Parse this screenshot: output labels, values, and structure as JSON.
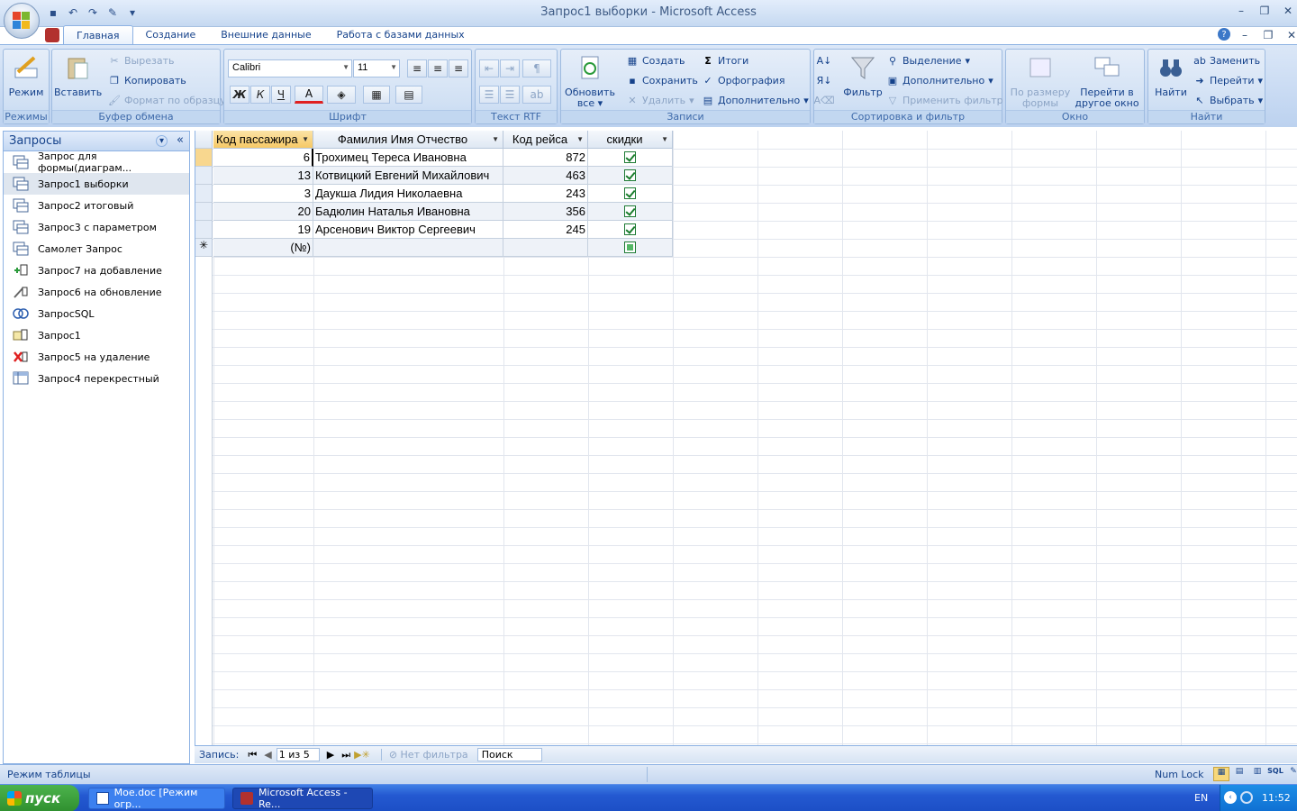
{
  "window": {
    "title": "Запрос1 выборки - Microsoft Access"
  },
  "tabs": [
    "Главная",
    "Создание",
    "Внешние данные",
    "Работа с базами данных"
  ],
  "ribbon": {
    "modes": {
      "group": "Режимы",
      "view": "Режим"
    },
    "clipboard": {
      "group": "Буфер обмена",
      "paste": "Вставить",
      "cut": "Вырезать",
      "copy": "Копировать",
      "format_painter": "Формат по образцу"
    },
    "font": {
      "group": "Шрифт",
      "family": "Calibri",
      "size": "11",
      "bold": "Ж",
      "italic": "К",
      "underline": "Ч",
      "font_color_glyph": "А"
    },
    "rtf": {
      "group": "Текст RTF"
    },
    "records": {
      "group": "Записи",
      "refresh": "Обновить все",
      "new": "Создать",
      "save": "Сохранить",
      "delete": "Удалить",
      "totals": "Итоги",
      "spelling": "Орфография",
      "more": "Дополнительно"
    },
    "sort": {
      "group": "Сортировка и фильтр",
      "filter": "Фильтр",
      "selection": "Выделение",
      "advanced": "Дополнительно",
      "toggle": "Применить фильтр"
    },
    "window": {
      "group": "Окно",
      "fit": "По размеру формы",
      "switch": "Перейти в другое окно"
    },
    "find": {
      "group": "Найти",
      "find": "Найти",
      "replace": "Заменить",
      "goto": "Перейти",
      "select": "Выбрать"
    }
  },
  "nav": {
    "header": "Запросы",
    "items": [
      {
        "label": "Запрос для формы(диаграм...",
        "icon": "select-query-icon"
      },
      {
        "label": "Запрос1 выборки",
        "icon": "select-query-icon",
        "selected": true
      },
      {
        "label": "Запрос2 итоговый",
        "icon": "select-query-icon"
      },
      {
        "label": "Запрос3 с параметром",
        "icon": "select-query-icon"
      },
      {
        "label": "Самолет Запрос",
        "icon": "select-query-icon"
      },
      {
        "label": "Запрос7 на добавление",
        "icon": "append-query-icon"
      },
      {
        "label": "Запрос6 на обновление",
        "icon": "update-query-icon"
      },
      {
        "label": "ЗапросSQL",
        "icon": "union-query-icon"
      },
      {
        "label": "Запрос1",
        "icon": "make-table-query-icon"
      },
      {
        "label": "Запрос5 на удаление",
        "icon": "delete-query-icon"
      },
      {
        "label": "Запрос4 перекрестный",
        "icon": "crosstab-query-icon"
      }
    ]
  },
  "table": {
    "columns": [
      "Код пассажира",
      "Фамилия Имя Отчество",
      "Код рейса",
      "скидки"
    ],
    "rows": [
      {
        "id": "6",
        "name": "Трохимец Тереса Ивановна",
        "flight": "872",
        "discount": true
      },
      {
        "id": "13",
        "name": "Котвицкий Евгений Михайлович",
        "flight": "463",
        "discount": true
      },
      {
        "id": "3",
        "name": "Даукша Лидия Николаевна",
        "flight": "243",
        "discount": true
      },
      {
        "id": "20",
        "name": "Бадюлин Наталья Ивановна",
        "flight": "356",
        "discount": true
      },
      {
        "id": "19",
        "name": "Арсенович Виктор Сергеевич",
        "flight": "245",
        "discount": true
      }
    ],
    "new_row": {
      "marker": "✳",
      "id": "(№)"
    }
  },
  "record_nav": {
    "label": "Запись:",
    "position": "1 из 5",
    "filter": "Нет фильтра",
    "search": "Поиск"
  },
  "status": {
    "mode": "Режим таблицы",
    "numlock": "Num Lock"
  },
  "taskbar": {
    "start": "пуск",
    "tasks": [
      "Мое.doc [Режим огр...",
      "Microsoft Access - Re..."
    ],
    "lang": "EN",
    "time": "11:52"
  },
  "colors": {
    "accent": "#15428b",
    "ribbon": "#c5d8f2",
    "taskbar": "#2459d1"
  }
}
